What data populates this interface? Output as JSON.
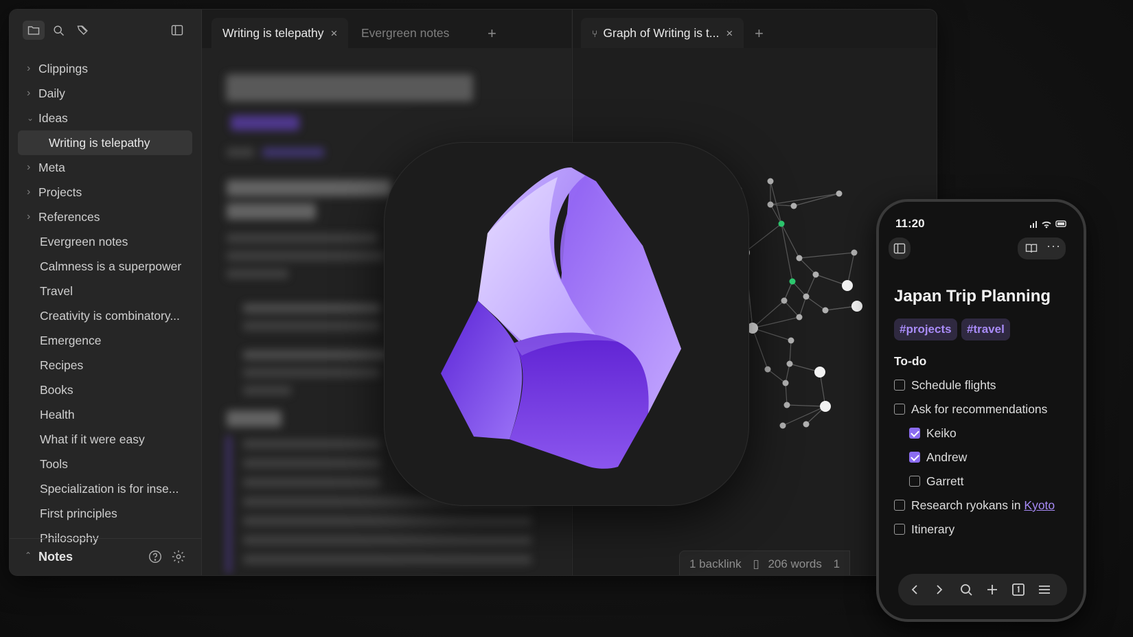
{
  "sidebar": {
    "icons": [
      "folder-icon",
      "search-icon",
      "bookmark-tags-icon",
      "sidebar-toggle-icon"
    ],
    "tree": [
      {
        "label": "Clippings",
        "type": "folder",
        "expanded": false
      },
      {
        "label": "Daily",
        "type": "folder",
        "expanded": false
      },
      {
        "label": "Ideas",
        "type": "folder",
        "expanded": true
      },
      {
        "label": "Writing is telepathy",
        "type": "file-child",
        "selected": true
      },
      {
        "label": "Meta",
        "type": "folder",
        "expanded": false
      },
      {
        "label": "Projects",
        "type": "folder",
        "expanded": false
      },
      {
        "label": "References",
        "type": "folder",
        "expanded": false
      },
      {
        "label": "Evergreen notes",
        "type": "file"
      },
      {
        "label": "Calmness is a superpower",
        "type": "file"
      },
      {
        "label": "Travel",
        "type": "file"
      },
      {
        "label": "Creativity is combinatory...",
        "type": "file"
      },
      {
        "label": "Emergence",
        "type": "file"
      },
      {
        "label": "Recipes",
        "type": "file"
      },
      {
        "label": "Books",
        "type": "file"
      },
      {
        "label": "Health",
        "type": "file"
      },
      {
        "label": "What if it were easy",
        "type": "file"
      },
      {
        "label": "Tools",
        "type": "file"
      },
      {
        "label": "Specialization is for inse...",
        "type": "file"
      },
      {
        "label": "First principles",
        "type": "file"
      },
      {
        "label": "Philosophy",
        "type": "file"
      }
    ],
    "vault_name": "Notes"
  },
  "tabs_left": {
    "active": "Writing is telepathy",
    "inactive": "Evergreen notes",
    "close": "×",
    "add": "+"
  },
  "tabs_right": {
    "active": "Graph of Writing is t...",
    "close": "×",
    "add": "+"
  },
  "status_bar": {
    "backlinks": "1 backlink",
    "words": "206 words",
    "extra": "1"
  },
  "colors": {
    "accent": "#8b6cf0",
    "accent_text": "#a88bf7",
    "graph_green": "#2ecc71"
  },
  "phone": {
    "time": "11:20",
    "title": "Japan Trip Planning",
    "tags": [
      "#projects",
      "#travel"
    ],
    "section": "To-do",
    "todos": [
      {
        "text": "Schedule flights",
        "checked": false,
        "indent": 0
      },
      {
        "text": "Ask for recommendations",
        "checked": false,
        "indent": 0
      },
      {
        "text": "Keiko",
        "checked": true,
        "indent": 1
      },
      {
        "text": "Andrew",
        "checked": true,
        "indent": 1
      },
      {
        "text": "Garrett",
        "checked": false,
        "indent": 1
      },
      {
        "text": "Research ryokans in ",
        "link": "Kyoto",
        "checked": false,
        "indent": 0
      },
      {
        "text": "Itinerary",
        "checked": false,
        "indent": 0
      }
    ]
  }
}
